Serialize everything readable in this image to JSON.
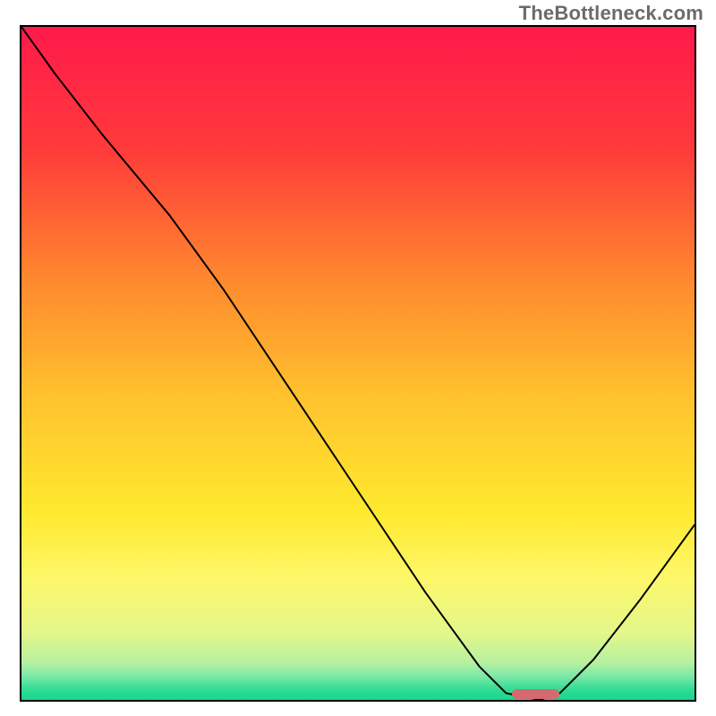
{
  "watermark": "TheBottleneck.com",
  "chart_data": {
    "type": "line",
    "title": "",
    "xlabel": "",
    "ylabel": "",
    "xlim": [
      0,
      100
    ],
    "ylim": [
      0,
      100
    ],
    "grid": false,
    "legend": false,
    "background_gradient": {
      "stops": [
        {
          "pos": 0.0,
          "color": "#ff1a4b"
        },
        {
          "pos": 0.18,
          "color": "#ff3a3a"
        },
        {
          "pos": 0.38,
          "color": "#ff8a2e"
        },
        {
          "pos": 0.55,
          "color": "#ffc22e"
        },
        {
          "pos": 0.72,
          "color": "#ffe92e"
        },
        {
          "pos": 0.82,
          "color": "#fdf76a"
        },
        {
          "pos": 0.9,
          "color": "#e4f78a"
        },
        {
          "pos": 0.945,
          "color": "#b6f0a0"
        },
        {
          "pos": 0.965,
          "color": "#7be8a6"
        },
        {
          "pos": 0.985,
          "color": "#2fdc95"
        },
        {
          "pos": 1.0,
          "color": "#18d68c"
        }
      ]
    },
    "series": [
      {
        "name": "bottleneck-curve",
        "x": [
          0,
          5,
          12,
          22,
          30,
          40,
          50,
          60,
          68,
          72,
          77,
          80,
          85,
          92,
          100
        ],
        "y": [
          100,
          93,
          84,
          72,
          61,
          46,
          31,
          16,
          5,
          1,
          0,
          1,
          6,
          15,
          26
        ]
      }
    ],
    "marker": {
      "name": "optimal-range",
      "x_start": 73,
      "x_end": 80,
      "y": 0.8,
      "color": "#d46a6f"
    }
  }
}
